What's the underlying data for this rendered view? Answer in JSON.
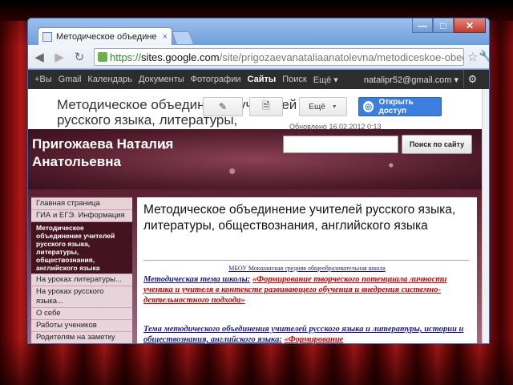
{
  "browser": {
    "tab_title": "Методическое объедине",
    "tab_close": "×",
    "window_buttons": [
      "—",
      "□",
      "✕"
    ],
    "url": {
      "scheme": "https://",
      "host": "sites.google.com",
      "path": "/site/prigozaevanataliaanatolevna/metodiceskoe-obediner"
    }
  },
  "google_bar": {
    "items": [
      "+Вы",
      "Gmail",
      "Календарь",
      "Документы",
      "Фотографии",
      "Сайты",
      "Поиск",
      "Ещё ▾"
    ],
    "active_item": "Сайты",
    "email": "natalipr52@gmail.com ▾"
  },
  "header": {
    "site_page_title": "Методическое объединение учителей русского языка, литературы, обществознания, английского языка",
    "more_label": "Ещё",
    "share_label": "Открыть доступ",
    "updated": "Обновлено 16.02.2012 0:13"
  },
  "banner": {
    "site_name": "Пригожаева Наталия Анатольевна",
    "search_button": "Поиск по сайту"
  },
  "sidebar": {
    "items": [
      "Главная страница",
      "ГИА и ЕГЭ. Информация",
      "Методическое объединение учителей русского языка, литературы, обществознания, английского языка",
      "На уроках литературы...",
      "На уроках русского языка...",
      "О себе",
      "Работы учеников",
      "Родителям на заметку"
    ]
  },
  "content": {
    "heading": "Методическое объединение учителей русского языка, литературы, обществознания, английского языка",
    "school": "МБОУ Мокшанская средняя общеобразовательная школа",
    "theme_label": "Методическая тема школы:",
    "theme_value": "«Формирование творческого потенциала личности ученика и учителя в контексте развивающего обучения и внедрения системно-деятельностного подхода»",
    "mo_label": "Тема методического объединения учителей русского языка и литературы, истории и обществознания, английского языка:",
    "mo_value": "«Формирование"
  },
  "colors": {
    "gbar_bg": "#2d2d2d",
    "share_blue": "#3c7de0",
    "banner_maroon": "#4d1a29",
    "link_red": "#c00000",
    "link_blue": "#1a1a8a"
  }
}
